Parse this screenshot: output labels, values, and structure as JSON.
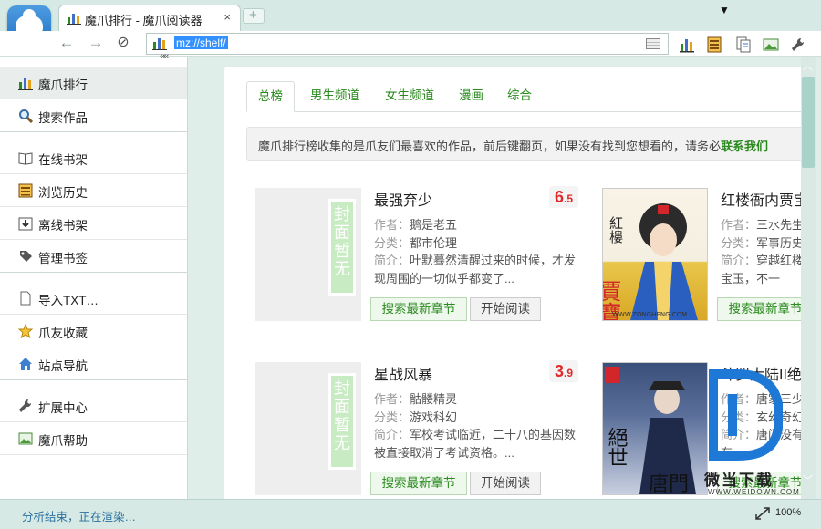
{
  "window": {
    "tab_title": "魔爪排行 - 魔爪阅读器",
    "tab_close": "×",
    "newtab_label": "+",
    "pin": "📌"
  },
  "toolbar": {
    "back": "←",
    "forward": "→",
    "stop": "⊘",
    "address": "mz://shelf/"
  },
  "sidebar": {
    "collapse": "««",
    "items": [
      {
        "label": "魔爪排行",
        "icon": "ranking-bars-icon"
      },
      {
        "label": "搜索作品",
        "icon": "magnifier-icon"
      },
      {
        "label": "在线书架",
        "icon": "open-book-icon"
      },
      {
        "label": "浏览历史",
        "icon": "history-icon"
      },
      {
        "label": "离线书架",
        "icon": "download-icon"
      },
      {
        "label": "管理书签",
        "icon": "bookmark-tag-icon"
      },
      {
        "label": "导入TXT…",
        "icon": "document-icon"
      },
      {
        "label": "爪友收藏",
        "icon": "star-icon"
      },
      {
        "label": "站点导航",
        "icon": "home-icon"
      },
      {
        "label": "扩展中心",
        "icon": "wrench-icon"
      },
      {
        "label": "魔爪帮助",
        "icon": "help-icon"
      }
    ]
  },
  "content": {
    "tabs": [
      "总榜",
      "男生频道",
      "女生频道",
      "漫画",
      "综合"
    ],
    "notice_text": "魔爪排行榜收集的是爪友们最喜欢的作品，前后键翻页，如果没有找到您想看的，请务必",
    "notice_link": "联系我们",
    "labels": {
      "author": "作者：",
      "category": "分类：",
      "intro": "简介：",
      "search_btn": "搜索最新章节",
      "read_btn": "开始阅读",
      "no_cover": "封面暂无"
    },
    "books": [
      {
        "title": "最强弃少",
        "score_int": "6",
        "score_dec": ".5",
        "author": "鹅是老五",
        "category": "都市伦理",
        "intro": "叶默蓦然清醒过来的时候，才发现周围的一切似乎都变了...",
        "has_cover": false
      },
      {
        "title": "红楼衙内贾宝",
        "score_int": "",
        "score_dec": "",
        "author": "三水先生",
        "category": "军事历史",
        "intro": "穿越红楼的贾宝玉，不一",
        "has_cover": true,
        "cover_text": "红楼衙内贾宝玉"
      },
      {
        "title": "星战风暴",
        "score_int": "3",
        "score_dec": ".9",
        "author": "骷髅精灵",
        "category": "游戏科幻",
        "intro": "军校考试临近，二十八的基因数被直接取消了考试资格。...",
        "has_cover": false
      },
      {
        "title": "斗罗大陆II绝",
        "score_int": "",
        "score_dec": "",
        "author": "唐家三少",
        "category": "玄幻奇幻",
        "intro": "唐门没有…却有",
        "has_cover": true,
        "cover_text": "绝世唐门"
      }
    ]
  },
  "watermark": {
    "text": "微当下载",
    "url": "WWW.WEIDOWN.COM"
  },
  "status": {
    "text": "分析结束，正在渲染…",
    "zoom": "100%"
  },
  "colors": {
    "accent_green": "#2a8a1e",
    "score_red": "#e02a2a",
    "link_blue": "#2a6f9e",
    "frame_teal": "#d6e9e4"
  }
}
